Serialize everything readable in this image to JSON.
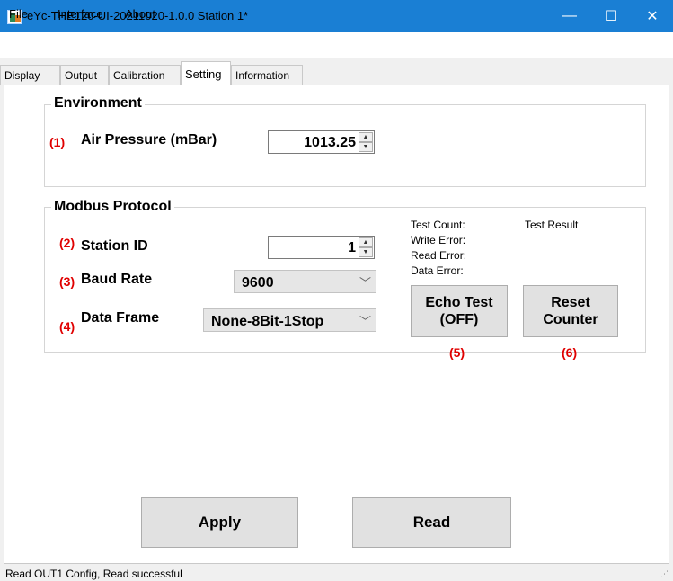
{
  "window": {
    "title": "eYc-THE120-UI-20211020-1.0.0  Station 1*",
    "minimize_glyph": "—",
    "maximize_glyph": "☐",
    "close_glyph": "✕"
  },
  "menu": [
    "File",
    "Interface",
    "About"
  ],
  "tabs": [
    "Display",
    "Output",
    "Calibration",
    "Setting",
    "Information"
  ],
  "active_tab": "Setting",
  "environment": {
    "title": "Environment",
    "air_pressure": {
      "num": "(1)",
      "label": "Air Pressure (mBar)",
      "value": "1013.25"
    }
  },
  "modbus": {
    "title": "Modbus Protocol",
    "station_id": {
      "num": "(2)",
      "label": "Station ID",
      "value": "1"
    },
    "baud_rate": {
      "num": "(3)",
      "label": "Baud Rate",
      "value": "9600"
    },
    "data_frame": {
      "num": "(4)",
      "label": "Data Frame",
      "value": "None-8Bit-1Stop"
    },
    "stats": {
      "test_count": "Test Count:",
      "test_result": "Test Result",
      "write_error": "Write Error:",
      "read_error": "Read Error:",
      "data_error": "Data Error:"
    },
    "echo_test": {
      "line1": "Echo Test",
      "line2": "(OFF)",
      "num": "(5)"
    },
    "reset_counter": {
      "line1": "Reset",
      "line2": "Counter",
      "num": "(6)"
    }
  },
  "buttons": {
    "apply": "Apply",
    "read": "Read"
  },
  "status": "Read OUT1 Config,   Read successful",
  "icons": {
    "up": "▲",
    "down": "▼",
    "chevron": "﹀",
    "size_grip": "⋰"
  },
  "colors": {
    "titlebar": "#1a7fd4",
    "annotation_red": "#e00000"
  }
}
